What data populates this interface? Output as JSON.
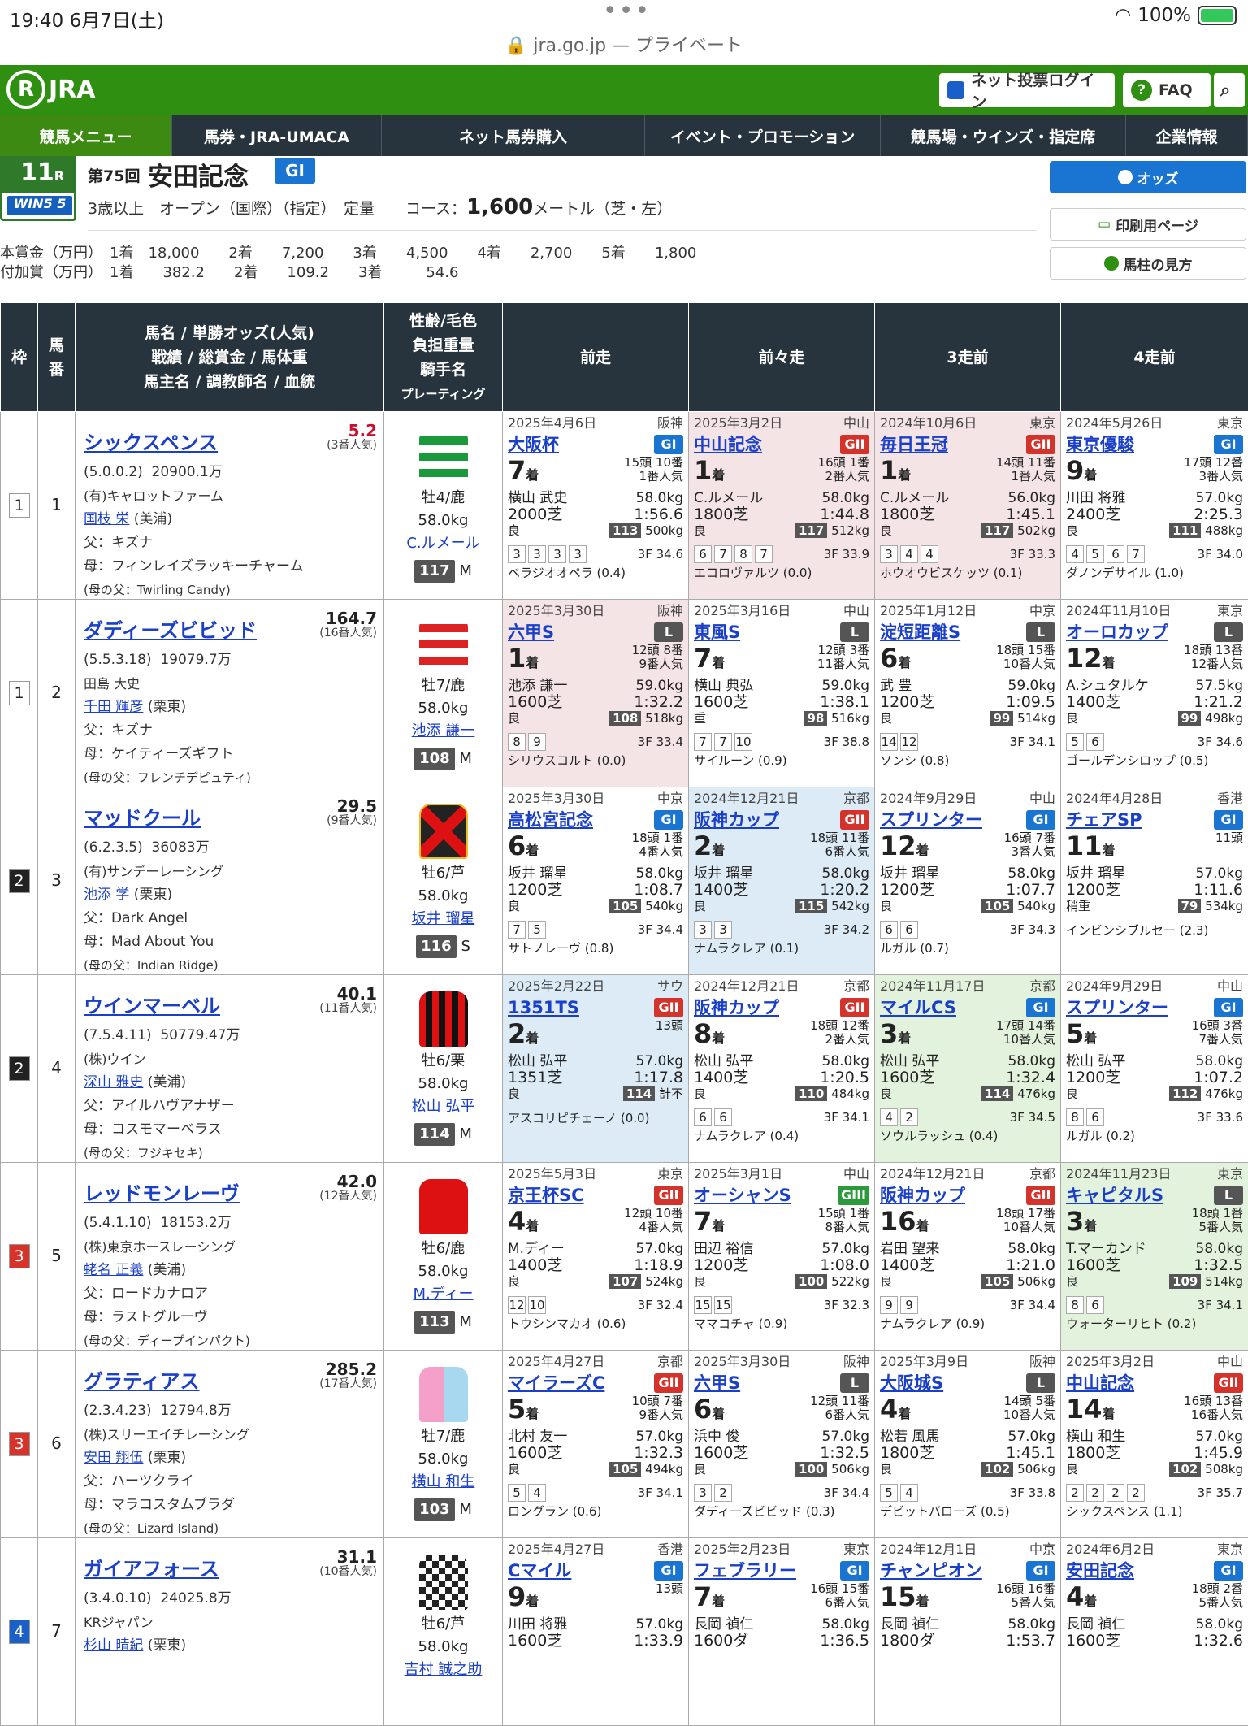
{
  "status": {
    "time": "19:40  6月7日(土)",
    "battery": "100%",
    "dots": "•••"
  },
  "url": "jra.go.jp — プライベート",
  "header": {
    "logo": "JRA",
    "login": "ネット投票ログイン",
    "faq": "FAQ"
  },
  "nav": [
    "競馬メニュー",
    "馬券・JRA-UMACA",
    "ネット馬券購入",
    "イベント・プロモーション",
    "競馬場・ウインズ・指定席",
    "企業情報"
  ],
  "race": {
    "num": "11",
    "r": "R",
    "kai": "第75回",
    "name": "安田記念",
    "grade": "GI",
    "win5": "WIN5 5",
    "cond": "3歳以上　オープン（国際）（指定）　定量　　コース：",
    "dist": "1,600",
    "cond2": "メートル（芝・左）"
  },
  "prize": {
    "main": "本賞金（万円）　1着　18,000　　2着　　7,200　　3着　　4,500　　4着　　2,700　　5着　　1,800",
    "add": "付加賞（万円）　1着　　382.2　　2着　　109.2　　3着　　　54.6"
  },
  "side": {
    "odds": "オッズ",
    "print": "印刷用ページ",
    "guide": "馬柱の見方"
  },
  "th": {
    "waku": "枠",
    "uma": "馬\n番",
    "horse": "馬名 / 単勝オッズ(人気)\n戦績 / 総賞金 / 馬体重\n馬主名 / 調教師名 / 血統",
    "jockey": "性齢/毛色\n負担重量\n騎手名",
    "pr": "プレーティング",
    "p1": "前走",
    "p2": "前々走",
    "p3": "3走前",
    "p4": "4走前"
  },
  "horses": [
    {
      "waku": "1",
      "uma": "1",
      "name": "シックスペンス",
      "odds": "5.2",
      "pop": "(3番人気)",
      "rec": "(5.0.0.2)  20900.1万",
      "owner": "(有)キャロットファーム",
      "trainer": "国枝 栄",
      "loc": " (美浦)",
      "sire": "父：キズナ",
      "dam": "母：フィンレイズラッキーチャーム",
      "ms": "(母の父：Twirling Candy)",
      "sex": "牡4/鹿",
      "wt": "58.0kg",
      "jockey": "C.ルメール",
      "rating": "117",
      "mark": "M",
      "past": [
        {
          "date": "2025年4月6日",
          "course": "阪神",
          "race": "大阪杯",
          "grade": "GI",
          "pos": "7",
          "field": "15頭 10番",
          "pop": "1番人気",
          "jk": "横山 武史",
          "kg": "58.0kg",
          "dist": "2000芝",
          "time": "1:56.6",
          "cond": "良",
          "rt": "113",
          "bw": "500kg",
          "corner": [
            "3",
            "3",
            "3",
            "3"
          ],
          "f3": "3F 34.6",
          "winner": "ベラジオオペラ (0.4)"
        },
        {
          "date": "2025年3月2日",
          "course": "中山",
          "race": "中山記念",
          "grade": "GII",
          "pos": "1",
          "field": "16頭 1番",
          "pop": "2番人気",
          "jk": "C.ルメール",
          "kg": "58.0kg",
          "dist": "1800芝",
          "time": "1:44.8",
          "cond": "良",
          "rt": "117",
          "bw": "512kg",
          "corner": [
            "6",
            "7",
            "8",
            "7"
          ],
          "f3": "3F 33.9",
          "winner": "エコロヴァルツ (0.0)"
        },
        {
          "date": "2024年10月6日",
          "course": "東京",
          "race": "毎日王冠",
          "grade": "GII",
          "pos": "1",
          "field": "14頭 11番",
          "pop": "1番人気",
          "jk": "C.ルメール",
          "kg": "56.0kg",
          "dist": "1800芝",
          "time": "1:45.1",
          "cond": "良",
          "rt": "117",
          "bw": "502kg",
          "corner": [
            "3",
            "4",
            "4"
          ],
          "f3": "3F 33.3",
          "winner": "ホウオウビスケッツ (0.1)"
        },
        {
          "date": "2024年5月26日",
          "course": "東京",
          "race": "東京優駿",
          "grade": "GI",
          "pos": "9",
          "field": "17頭 12番",
          "pop": "3番人気",
          "jk": "川田 将雅",
          "kg": "57.0kg",
          "dist": "2400芝",
          "time": "2:25.3",
          "cond": "良",
          "rt": "111",
          "bw": "488kg",
          "corner": [
            "4",
            "5",
            "6",
            "7"
          ],
          "f3": "3F 34.0",
          "winner": "ダノンデサイル (1.0)"
        }
      ]
    },
    {
      "waku": "1",
      "uma": "2",
      "name": "ダディーズビビッド",
      "odds": "164.7",
      "pop": "(16番人気)",
      "rec": "(5.5.3.18)  19079.7万",
      "owner": "田島 大史",
      "trainer": "千田 輝彦",
      "loc": " (栗東)",
      "sire": "父：キズナ",
      "dam": "母：ケイティーズギフト",
      "ms": "(母の父：フレンチデピュティ)",
      "sex": "牡7/鹿",
      "wt": "58.0kg",
      "jockey": "池添 謙一",
      "rating": "108",
      "mark": "M",
      "past": [
        {
          "date": "2025年3月30日",
          "course": "阪神",
          "race": "六甲S",
          "grade": "L",
          "pos": "1",
          "field": "12頭 8番",
          "pop": "9番人気",
          "jk": "池添 謙一",
          "kg": "59.0kg",
          "dist": "1600芝",
          "time": "1:32.2",
          "cond": "良",
          "rt": "108",
          "bw": "518kg",
          "corner": [
            "8",
            "9"
          ],
          "f3": "3F 33.4",
          "winner": "シリウスコルト (0.0)"
        },
        {
          "date": "2025年3月16日",
          "course": "中山",
          "race": "東風S",
          "grade": "L",
          "pos": "7",
          "field": "12頭 3番",
          "pop": "11番人気",
          "jk": "横山 典弘",
          "kg": "59.0kg",
          "dist": "1600芝",
          "time": "1:38.1",
          "cond": "重",
          "rt": "98",
          "bw": "516kg",
          "corner": [
            "7",
            "7",
            "10"
          ],
          "f3": "3F 38.8",
          "winner": "サイルーン (0.9)"
        },
        {
          "date": "2025年1月12日",
          "course": "中京",
          "race": "淀短距離S",
          "grade": "L",
          "pos": "6",
          "field": "18頭 15番",
          "pop": "10番人気",
          "jk": "武 豊",
          "kg": "59.0kg",
          "dist": "1200芝",
          "time": "1:09.5",
          "cond": "良",
          "rt": "99",
          "bw": "514kg",
          "corner": [
            "14",
            "12"
          ],
          "f3": "3F 34.1",
          "winner": "ソンシ (0.8)"
        },
        {
          "date": "2024年11月10日",
          "course": "東京",
          "race": "オーロカップ",
          "grade": "L",
          "pos": "12",
          "field": "18頭 13番",
          "pop": "12番人気",
          "jk": "A.シュタルケ",
          "kg": "57.5kg",
          "dist": "1400芝",
          "time": "1:21.2",
          "cond": "良",
          "rt": "99",
          "bw": "498kg",
          "corner": [
            "5",
            "6"
          ],
          "f3": "3F 34.6",
          "winner": "ゴールデンシロップ (0.5)"
        }
      ]
    },
    {
      "waku": "2",
      "uma": "3",
      "name": "マッドクール",
      "odds": "29.5",
      "pop": "(9番人気)",
      "rec": "(6.2.3.5)  36083万",
      "owner": "(有)サンデーレーシング",
      "trainer": "池添 学",
      "loc": " (栗東)",
      "sire": "父：Dark Angel",
      "dam": "母：Mad About You",
      "ms": "(母の父：Indian Ridge)",
      "sex": "牡6/芦",
      "wt": "58.0kg",
      "jockey": "坂井 瑠星",
      "rating": "116",
      "mark": "S",
      "past": [
        {
          "date": "2025年3月30日",
          "course": "中京",
          "race": "高松宮記念",
          "grade": "GI",
          "pos": "6",
          "field": "18頭 1番",
          "pop": "4番人気",
          "jk": "坂井 瑠星",
          "kg": "58.0kg",
          "dist": "1200芝",
          "time": "1:08.7",
          "cond": "良",
          "rt": "105",
          "bw": "540kg",
          "corner": [
            "7",
            "5"
          ],
          "f3": "3F 34.4",
          "winner": "サトノレーヴ (0.8)"
        },
        {
          "date": "2024年12月21日",
          "course": "京都",
          "race": "阪神カップ",
          "grade": "GII",
          "pos": "2",
          "field": "18頭 11番",
          "pop": "6番人気",
          "jk": "坂井 瑠星",
          "kg": "58.0kg",
          "dist": "1400芝",
          "time": "1:20.2",
          "cond": "良",
          "rt": "115",
          "bw": "542kg",
          "corner": [
            "3",
            "3"
          ],
          "f3": "3F 34.2",
          "winner": "ナムラクレア (0.1)"
        },
        {
          "date": "2024年9月29日",
          "course": "中山",
          "race": "スプリンター",
          "grade": "GI",
          "pos": "12",
          "field": "16頭 7番",
          "pop": "3番人気",
          "jk": "坂井 瑠星",
          "kg": "58.0kg",
          "dist": "1200芝",
          "time": "1:07.7",
          "cond": "良",
          "rt": "105",
          "bw": "540kg",
          "corner": [
            "6",
            "6"
          ],
          "f3": "3F 34.3",
          "winner": "ルガル (0.7)"
        },
        {
          "date": "2024年4月28日",
          "course": "香港",
          "race": "チェアSP",
          "grade": "GI",
          "pos": "11",
          "field": "11頭",
          "pop": "",
          "jk": "坂井 瑠星",
          "kg": "57.0kg",
          "dist": "1200芝",
          "time": "1:11.6",
          "cond": "稍重",
          "rt": "79",
          "bw": "534kg",
          "corner": [],
          "f3": "",
          "winner": "インビンシブルセー (2.3)"
        }
      ]
    },
    {
      "waku": "2",
      "uma": "4",
      "name": "ウインマーベル",
      "odds": "40.1",
      "pop": "(11番人気)",
      "rec": "(7.5.4.11)  50779.47万",
      "owner": "(株)ウイン",
      "trainer": "深山 雅史",
      "loc": " (美浦)",
      "sire": "父：アイルハヴアナザー",
      "dam": "母：コスモマーベラス",
      "ms": "(母の父：フジキセキ)",
      "sex": "牡6/栗",
      "wt": "58.0kg",
      "jockey": "松山 弘平",
      "rating": "114",
      "mark": "M",
      "past": [
        {
          "date": "2025年2月22日",
          "course": "サウ",
          "race": "1351TS",
          "grade": "GII",
          "pos": "2",
          "field": "13頭",
          "pop": "",
          "jk": "松山 弘平",
          "kg": "57.0kg",
          "dist": "1351芝",
          "time": "1:17.8",
          "cond": "良",
          "rt": "114",
          "bw": "計不",
          "corner": [],
          "f3": "",
          "winner": "アスコリピチェーノ (0.0)"
        },
        {
          "date": "2024年12月21日",
          "course": "京都",
          "race": "阪神カップ",
          "grade": "GII",
          "pos": "8",
          "field": "18頭 12番",
          "pop": "2番人気",
          "jk": "松山 弘平",
          "kg": "58.0kg",
          "dist": "1400芝",
          "time": "1:20.5",
          "cond": "良",
          "rt": "110",
          "bw": "484kg",
          "corner": [
            "6",
            "6"
          ],
          "f3": "3F 34.1",
          "winner": "ナムラクレア (0.4)"
        },
        {
          "date": "2024年11月17日",
          "course": "京都",
          "race": "マイルCS",
          "grade": "GI",
          "pos": "3",
          "field": "17頭 14番",
          "pop": "10番人気",
          "jk": "松山 弘平",
          "kg": "58.0kg",
          "dist": "1600芝",
          "time": "1:32.4",
          "cond": "良",
          "rt": "114",
          "bw": "476kg",
          "corner": [
            "4",
            "2"
          ],
          "f3": "3F 34.5",
          "winner": "ソウルラッシュ (0.4)"
        },
        {
          "date": "2024年9月29日",
          "course": "中山",
          "race": "スプリンター",
          "grade": "GI",
          "pos": "5",
          "field": "16頭 3番",
          "pop": "7番人気",
          "jk": "松山 弘平",
          "kg": "58.0kg",
          "dist": "1200芝",
          "time": "1:07.2",
          "cond": "良",
          "rt": "112",
          "bw": "476kg",
          "corner": [
            "8",
            "6"
          ],
          "f3": "3F 33.6",
          "winner": "ルガル (0.2)"
        }
      ]
    },
    {
      "waku": "3",
      "uma": "5",
      "name": "レッドモンレーヴ",
      "odds": "42.0",
      "pop": "(12番人気)",
      "rec": "(5.4.1.10)  18153.2万",
      "owner": "(株)東京ホースレーシング",
      "trainer": "蛯名 正義",
      "loc": " (美浦)",
      "sire": "父：ロードカナロア",
      "dam": "母：ラストグルーヴ",
      "ms": "(母の父：ディープインパクト)",
      "sex": "牡6/鹿",
      "wt": "58.0kg",
      "jockey": "M.ディー",
      "rating": "113",
      "mark": "M",
      "past": [
        {
          "date": "2025年5月3日",
          "course": "東京",
          "race": "京王杯SC",
          "grade": "GII",
          "pos": "4",
          "field": "12頭 10番",
          "pop": "4番人気",
          "jk": "M.ディー",
          "kg": "57.0kg",
          "dist": "1400芝",
          "time": "1:18.9",
          "cond": "良",
          "rt": "107",
          "bw": "524kg",
          "corner": [
            "12",
            "10"
          ],
          "f3": "3F 32.4",
          "winner": "トウシンマカオ (0.6)"
        },
        {
          "date": "2025年3月1日",
          "course": "中山",
          "race": "オーシャンS",
          "grade": "GIII",
          "pos": "7",
          "field": "15頭 1番",
          "pop": "8番人気",
          "jk": "田辺 裕信",
          "kg": "57.0kg",
          "dist": "1200芝",
          "time": "1:08.0",
          "cond": "良",
          "rt": "100",
          "bw": "522kg",
          "corner": [
            "15",
            "15"
          ],
          "f3": "3F 32.3",
          "winner": "ママコチャ (0.9)"
        },
        {
          "date": "2024年12月21日",
          "course": "京都",
          "race": "阪神カップ",
          "grade": "GII",
          "pos": "16",
          "field": "18頭 17番",
          "pop": "10番人気",
          "jk": "岩田 望来",
          "kg": "58.0kg",
          "dist": "1400芝",
          "time": "1:21.0",
          "cond": "良",
          "rt": "105",
          "bw": "506kg",
          "corner": [
            "9",
            "9"
          ],
          "f3": "3F 34.4",
          "winner": "ナムラクレア (0.9)"
        },
        {
          "date": "2024年11月23日",
          "course": "東京",
          "race": "キャピタルS",
          "grade": "L",
          "pos": "3",
          "field": "18頭 1番",
          "pop": "5番人気",
          "jk": "T.マーカンド",
          "kg": "58.0kg",
          "dist": "1600芝",
          "time": "1:32.5",
          "cond": "良",
          "rt": "109",
          "bw": "514kg",
          "corner": [
            "8",
            "6"
          ],
          "f3": "3F 34.1",
          "winner": "ウォーターリヒト (0.2)"
        }
      ]
    },
    {
      "waku": "3",
      "uma": "6",
      "name": "グラティアス",
      "odds": "285.2",
      "pop": "(17番人気)",
      "rec": "(2.3.4.23)  12794.8万",
      "owner": "(株)スリーエイチレーシング",
      "trainer": "安田 翔伍",
      "loc": " (栗東)",
      "sire": "父：ハーツクライ",
      "dam": "母：マラコスタムブラダ",
      "ms": "(母の父：Lizard Island)",
      "sex": "牡7/鹿",
      "wt": "58.0kg",
      "jockey": "横山 和生",
      "rating": "103",
      "mark": "M",
      "past": [
        {
          "date": "2025年4月27日",
          "course": "京都",
          "race": "マイラーズC",
          "grade": "GII",
          "pos": "5",
          "field": "10頭 7番",
          "pop": "9番人気",
          "jk": "北村 友一",
          "kg": "57.0kg",
          "dist": "1600芝",
          "time": "1:32.3",
          "cond": "良",
          "rt": "105",
          "bw": "494kg",
          "corner": [
            "5",
            "4"
          ],
          "f3": "3F 34.1",
          "winner": "ロングラン (0.6)"
        },
        {
          "date": "2025年3月30日",
          "course": "阪神",
          "race": "六甲S",
          "grade": "L",
          "pos": "6",
          "field": "12頭 11番",
          "pop": "6番人気",
          "jk": "浜中 俊",
          "kg": "57.0kg",
          "dist": "1600芝",
          "time": "1:32.5",
          "cond": "良",
          "rt": "100",
          "bw": "506kg",
          "corner": [
            "3",
            "2"
          ],
          "f3": "3F 34.4",
          "winner": "ダディーズビビッド (0.3)"
        },
        {
          "date": "2025年3月9日",
          "course": "阪神",
          "race": "大阪城S",
          "grade": "L",
          "pos": "4",
          "field": "14頭 5番",
          "pop": "10番人気",
          "jk": "松若 風馬",
          "kg": "57.0kg",
          "dist": "1800芝",
          "time": "1:45.1",
          "cond": "良",
          "rt": "102",
          "bw": "506kg",
          "corner": [
            "5",
            "4"
          ],
          "f3": "3F 33.8",
          "winner": "デビットバローズ (0.5)"
        },
        {
          "date": "2025年3月2日",
          "course": "中山",
          "race": "中山記念",
          "grade": "GII",
          "pos": "14",
          "field": "16頭 13番",
          "pop": "16番人気",
          "jk": "横山 和生",
          "kg": "57.0kg",
          "dist": "1800芝",
          "time": "1:45.9",
          "cond": "良",
          "rt": "102",
          "bw": "508kg",
          "corner": [
            "2",
            "2",
            "2",
            "2"
          ],
          "f3": "3F 35.7",
          "winner": "シックスペンス (1.1)"
        }
      ]
    },
    {
      "waku": "4",
      "uma": "7",
      "name": "ガイアフォース",
      "odds": "31.1",
      "pop": "(10番人気)",
      "rec": "(3.4.0.10)  24025.8万",
      "owner": "KRジャパン",
      "trainer": "杉山 晴紀",
      "loc": " (栗東)",
      "sire": "",
      "dam": "",
      "ms": "",
      "sex": "牡6/芦",
      "wt": "58.0kg",
      "jockey": "吉村 誠之助",
      "rating": "",
      "mark": "",
      "past": [
        {
          "date": "2025年4月27日",
          "course": "香港",
          "race": "Cマイル",
          "grade": "GI",
          "pos": "9",
          "field": "13頭",
          "pop": "",
          "jk": "川田 将雅",
          "kg": "57.0kg",
          "dist": "1600芝",
          "time": "1:33.9",
          "cond": "",
          "rt": "",
          "bw": "",
          "corner": [],
          "f3": "",
          "winner": ""
        },
        {
          "date": "2025年2月23日",
          "course": "東京",
          "race": "フェブラリー",
          "grade": "GI",
          "pos": "7",
          "field": "16頭 15番",
          "pop": "6番人気",
          "jk": "長岡 禎仁",
          "kg": "58.0kg",
          "dist": "1600ダ",
          "time": "1:36.5",
          "cond": "",
          "rt": "",
          "bw": "",
          "corner": [],
          "f3": "",
          "winner": ""
        },
        {
          "date": "2024年12月1日",
          "course": "中京",
          "race": "チャンピオン",
          "grade": "GI",
          "pos": "15",
          "field": "16頭 16番",
          "pop": "5番人気",
          "jk": "長岡 禎仁",
          "kg": "58.0kg",
          "dist": "1800ダ",
          "time": "1:53.7",
          "cond": "",
          "rt": "",
          "bw": "",
          "corner": [],
          "f3": "",
          "winner": ""
        },
        {
          "date": "2024年6月2日",
          "course": "東京",
          "race": "安田記念",
          "grade": "GI",
          "pos": "4",
          "field": "18頭 2番",
          "pop": "5番人気",
          "jk": "長岡 禎仁",
          "kg": "58.0kg",
          "dist": "1600芝",
          "time": "1:32.6",
          "cond": "",
          "rt": "",
          "bw": "",
          "corner": [],
          "f3": "",
          "winner": ""
        }
      ]
    }
  ]
}
